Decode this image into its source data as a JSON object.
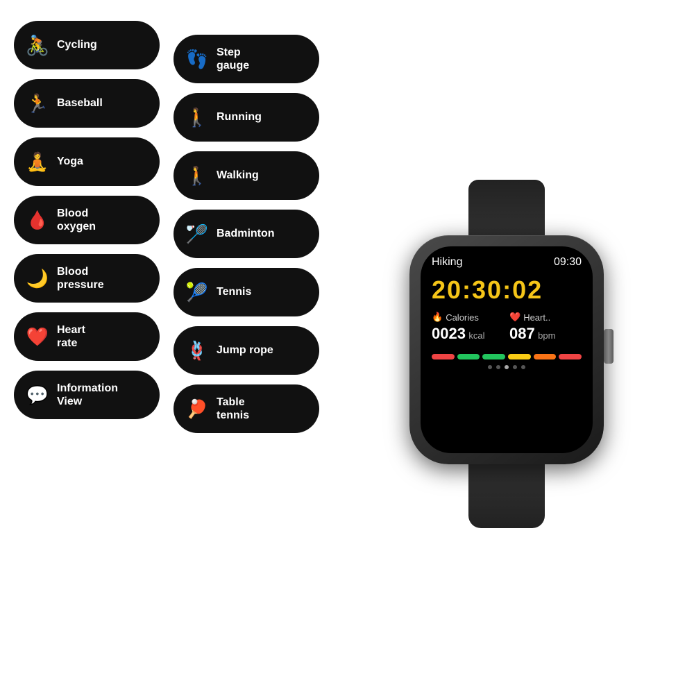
{
  "pills": {
    "left": [
      {
        "id": "cycling",
        "label": "Cycling",
        "icon": "🚴",
        "iconColor": "icon-green"
      },
      {
        "id": "baseball",
        "label": "Baseball",
        "icon": "🏃",
        "iconColor": "icon-blue"
      },
      {
        "id": "yoga",
        "label": "Yoga",
        "icon": "🧘",
        "iconColor": "icon-orange"
      },
      {
        "id": "blood-oxygen",
        "label": "Blood\noxygen",
        "icon": "🩸",
        "iconColor": "icon-red"
      },
      {
        "id": "blood-pressure",
        "label": "Blood\npressure",
        "icon": "🌙",
        "iconColor": "icon-teal"
      },
      {
        "id": "heart-rate",
        "label": "Heart\nrate",
        "icon": "❤️",
        "iconColor": "icon-red"
      },
      {
        "id": "information-view",
        "label": "Information\nView",
        "icon": "💬",
        "iconColor": "icon-green2"
      }
    ],
    "right": [
      {
        "id": "step-gauge",
        "label": "Step\ngauge",
        "icon": "👣",
        "iconColor": "icon-orange"
      },
      {
        "id": "running",
        "label": "Running",
        "icon": "🚶",
        "iconColor": "icon-blue"
      },
      {
        "id": "walking",
        "label": "Walking",
        "icon": "🚶",
        "iconColor": "icon-orange"
      },
      {
        "id": "badminton",
        "label": "Badminton",
        "icon": "🏸",
        "iconColor": "icon-orange"
      },
      {
        "id": "tennis",
        "label": "Tennis",
        "icon": "🎾",
        "iconColor": "icon-orange"
      },
      {
        "id": "jump-rope",
        "label": "Jump rope",
        "icon": "⭕",
        "iconColor": "icon-orange"
      },
      {
        "id": "table-tennis",
        "label": "Table\ntennis",
        "icon": "🏓",
        "iconColor": "icon-orange"
      }
    ]
  },
  "watch": {
    "title": "Hiking",
    "time": "09:30",
    "timer": "20:30:02",
    "calories_label": "Calories",
    "calories_value": "0023",
    "calories_unit": "kcal",
    "heart_label": "Heart..",
    "heart_value": "087",
    "heart_unit": "bpm",
    "progress_colors": [
      "#ef4444",
      "#22c55e",
      "#22c55e",
      "#facc15",
      "#f97316",
      "#ef4444"
    ],
    "dots": [
      false,
      false,
      true,
      false,
      false
    ]
  }
}
